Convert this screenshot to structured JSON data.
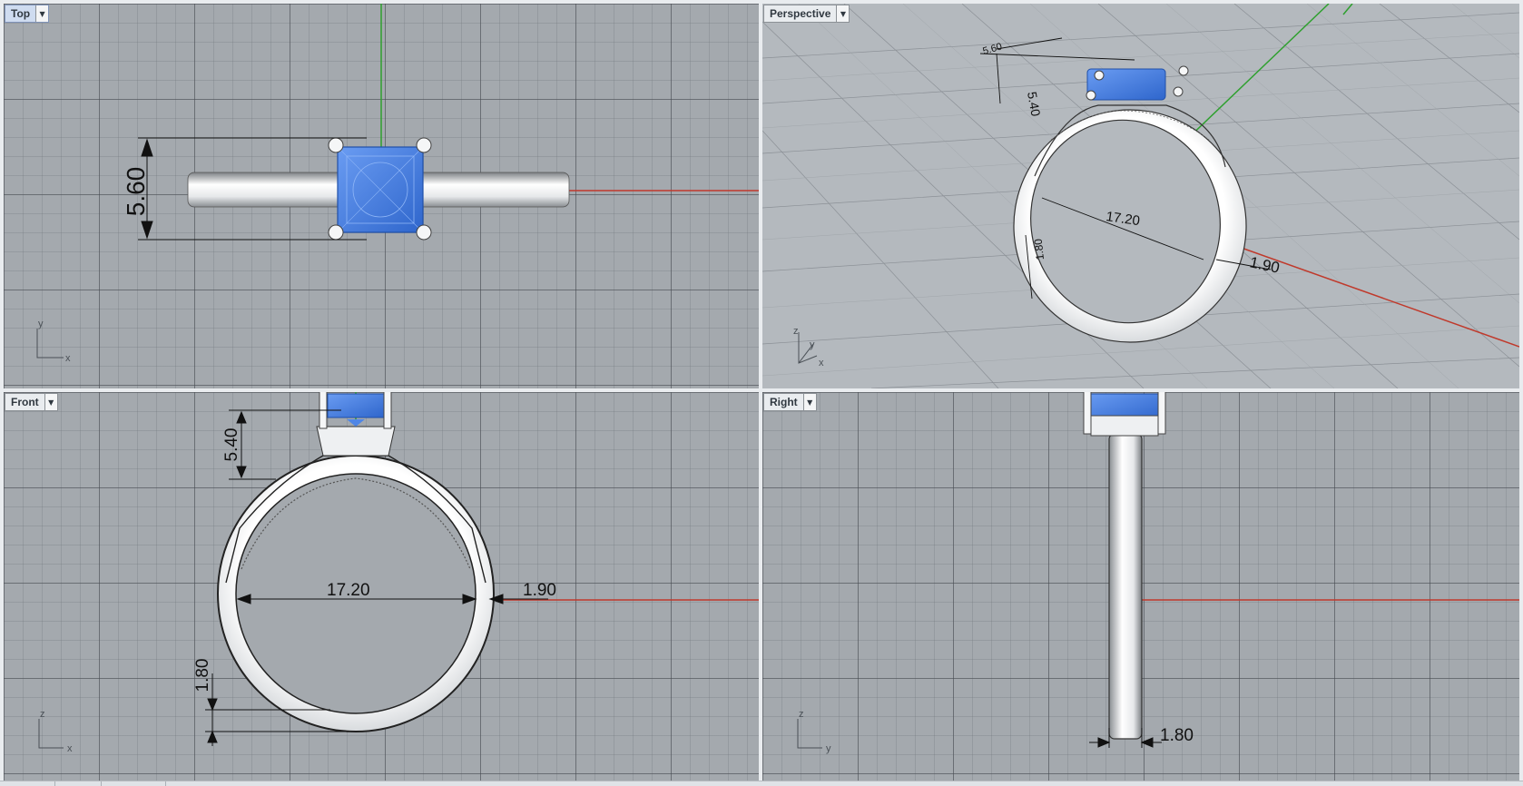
{
  "viewports": {
    "top": {
      "name": "Top",
      "active": true
    },
    "perspective": {
      "name": "Perspective",
      "active": false
    },
    "front": {
      "name": "Front",
      "active": false
    },
    "right": {
      "name": "Right",
      "active": false
    }
  },
  "dimensions": {
    "top_width": "5.60",
    "persp_stone_len": "5.60",
    "persp_head_height": "5.40",
    "persp_diameter": "17.20",
    "persp_thickness": "1.90",
    "persp_band_width": "1.80",
    "front_head_height": "5.40",
    "front_diameter": "17.20",
    "front_thickness": "1.90",
    "front_band_height": "1.80",
    "right_band_width": "1.80"
  },
  "axes": {
    "top": [
      "y",
      "x"
    ],
    "perspective": [
      "z",
      "y",
      "x"
    ],
    "front": [
      "z",
      "x"
    ],
    "right": [
      "z",
      "y"
    ]
  },
  "colors": {
    "viewport_bg": "#a4a9ae",
    "stone": "#4f86e6",
    "metal": "#eef0f2",
    "x_axis": "#c0392b",
    "y_axis": "#2ea02e",
    "active_tab": "#cfdcf0"
  }
}
